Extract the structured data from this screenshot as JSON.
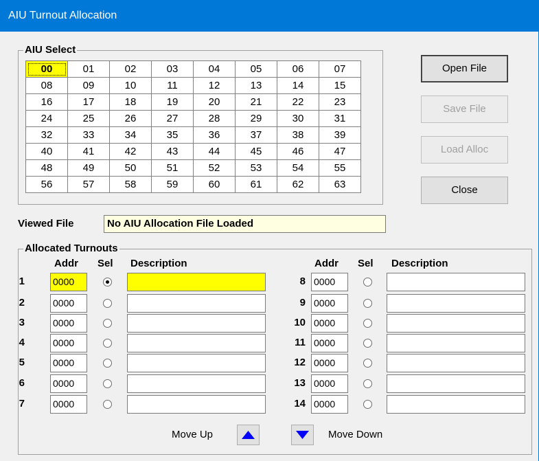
{
  "window": {
    "title": "AIU Turnout Allocation"
  },
  "aiu_select": {
    "label": "AIU Select",
    "selected": "00",
    "rows": [
      [
        "00",
        "01",
        "02",
        "03",
        "04",
        "05",
        "06",
        "07"
      ],
      [
        "08",
        "09",
        "10",
        "11",
        "12",
        "13",
        "14",
        "15"
      ],
      [
        "16",
        "17",
        "18",
        "19",
        "20",
        "21",
        "22",
        "23"
      ],
      [
        "24",
        "25",
        "26",
        "27",
        "28",
        "29",
        "30",
        "31"
      ],
      [
        "32",
        "33",
        "34",
        "35",
        "36",
        "37",
        "38",
        "39"
      ],
      [
        "40",
        "41",
        "42",
        "43",
        "44",
        "45",
        "46",
        "47"
      ],
      [
        "48",
        "49",
        "50",
        "51",
        "52",
        "53",
        "54",
        "55"
      ],
      [
        "56",
        "57",
        "58",
        "59",
        "60",
        "61",
        "62",
        "63"
      ]
    ]
  },
  "buttons": {
    "open_file": "Open File",
    "save_file": "Save File",
    "load_alloc": "Load Alloc",
    "close": "Close"
  },
  "viewed_file": {
    "label": "Viewed File",
    "value": "No AIU Allocation File Loaded"
  },
  "allocated": {
    "label": "Allocated Turnouts",
    "headers": {
      "addr": "Addr",
      "sel": "Sel",
      "description": "Description"
    },
    "left": [
      {
        "num": "1",
        "addr": "0000",
        "selected": true,
        "desc": ""
      },
      {
        "num": "2",
        "addr": "0000",
        "selected": false,
        "desc": ""
      },
      {
        "num": "3",
        "addr": "0000",
        "selected": false,
        "desc": ""
      },
      {
        "num": "4",
        "addr": "0000",
        "selected": false,
        "desc": ""
      },
      {
        "num": "5",
        "addr": "0000",
        "selected": false,
        "desc": ""
      },
      {
        "num": "6",
        "addr": "0000",
        "selected": false,
        "desc": ""
      },
      {
        "num": "7",
        "addr": "0000",
        "selected": false,
        "desc": ""
      }
    ],
    "right": [
      {
        "num": "8",
        "addr": "0000",
        "selected": false,
        "desc": ""
      },
      {
        "num": "9",
        "addr": "0000",
        "selected": false,
        "desc": ""
      },
      {
        "num": "10",
        "addr": "0000",
        "selected": false,
        "desc": ""
      },
      {
        "num": "11",
        "addr": "0000",
        "selected": false,
        "desc": ""
      },
      {
        "num": "12",
        "addr": "0000",
        "selected": false,
        "desc": ""
      },
      {
        "num": "13",
        "addr": "0000",
        "selected": false,
        "desc": ""
      },
      {
        "num": "14",
        "addr": "0000",
        "selected": false,
        "desc": ""
      }
    ]
  },
  "move": {
    "up_label": "Move Up",
    "down_label": "Move Down"
  },
  "colors": {
    "titlebar": "#0078d7",
    "highlight": "#ffff00",
    "viewed_file_bg": "#ffffe1",
    "arrow": "#0000ff"
  }
}
